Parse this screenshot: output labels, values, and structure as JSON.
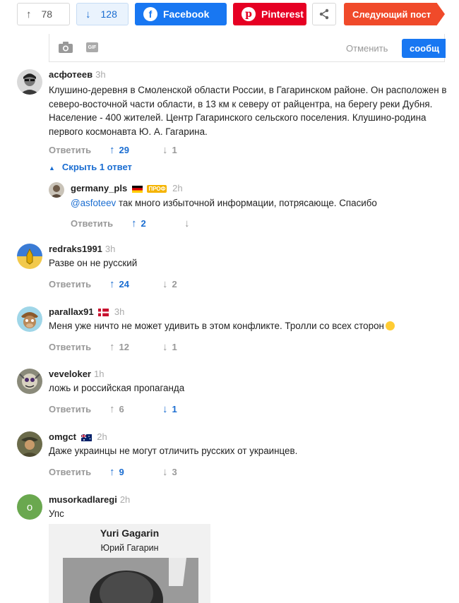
{
  "topbar": {
    "upvotes": "78",
    "downvotes": "128",
    "facebook_label": "Facebook",
    "pinterest_label": "Pinterest",
    "next_post_label": "Следующий пост"
  },
  "reply_box": {
    "gif_label": "GIF",
    "cancel_label": "Отменить",
    "submit_label": "сообщ"
  },
  "hide_replies_label": "Скрыть 1 ответ",
  "comments": [
    {
      "user": "асфотеев",
      "time": "3h",
      "text": "Клушино-деревня в Смоленской области России, в Гагаринском районе. Он расположен в северо-восточной части области, в 13 км к северу от райцентра, на берегу реки Дубня. Население - 400 жителей. Центр Гагаринского сельского поселения. Клушино-родина первого космонавта Ю. А. Гагарина.",
      "reply_label": "Ответить",
      "up": "29",
      "down": "1"
    },
    {
      "user": "germany_pls",
      "badge": "ПРОФ",
      "time": "2h",
      "mention": "@asfoteev",
      "text": " так много избыточной информации, потрясающе. Спасибо",
      "reply_label": "Ответить",
      "up": "2",
      "down": ""
    },
    {
      "user": "redraks1991",
      "time": "3h",
      "text": "Разве он не русский",
      "reply_label": "Ответить",
      "up": "24",
      "down": "2"
    },
    {
      "user": "parallax91",
      "time": "3h",
      "text": "Меня уже ничто не может удивить в этом конфликте. Тролли со всех сторон",
      "reply_label": "Ответить",
      "up": "12",
      "down": "1"
    },
    {
      "user": "veveloker",
      "time": "1h",
      "text": "ложь и российская пропаганда",
      "reply_label": "Ответить",
      "up": "6",
      "down": "1"
    },
    {
      "user": "omgct",
      "time": "2h",
      "text": "Даже украинцы не могут отличить русских от украинцев.",
      "reply_label": "Ответить",
      "up": "9",
      "down": "3"
    },
    {
      "user": "musorkadlaregi",
      "avatar_letter": "o",
      "time": "2h",
      "text": "Упс",
      "image_title": "Yuri Gagarin",
      "image_subtitle": "Юрий Гагарин"
    }
  ],
  "colors": {
    "accent_blue": "#1a6dd1",
    "facebook": "#1877f2",
    "pinterest": "#e60023",
    "next_post": "#f04a2a",
    "pro_badge": "#f5b400"
  }
}
